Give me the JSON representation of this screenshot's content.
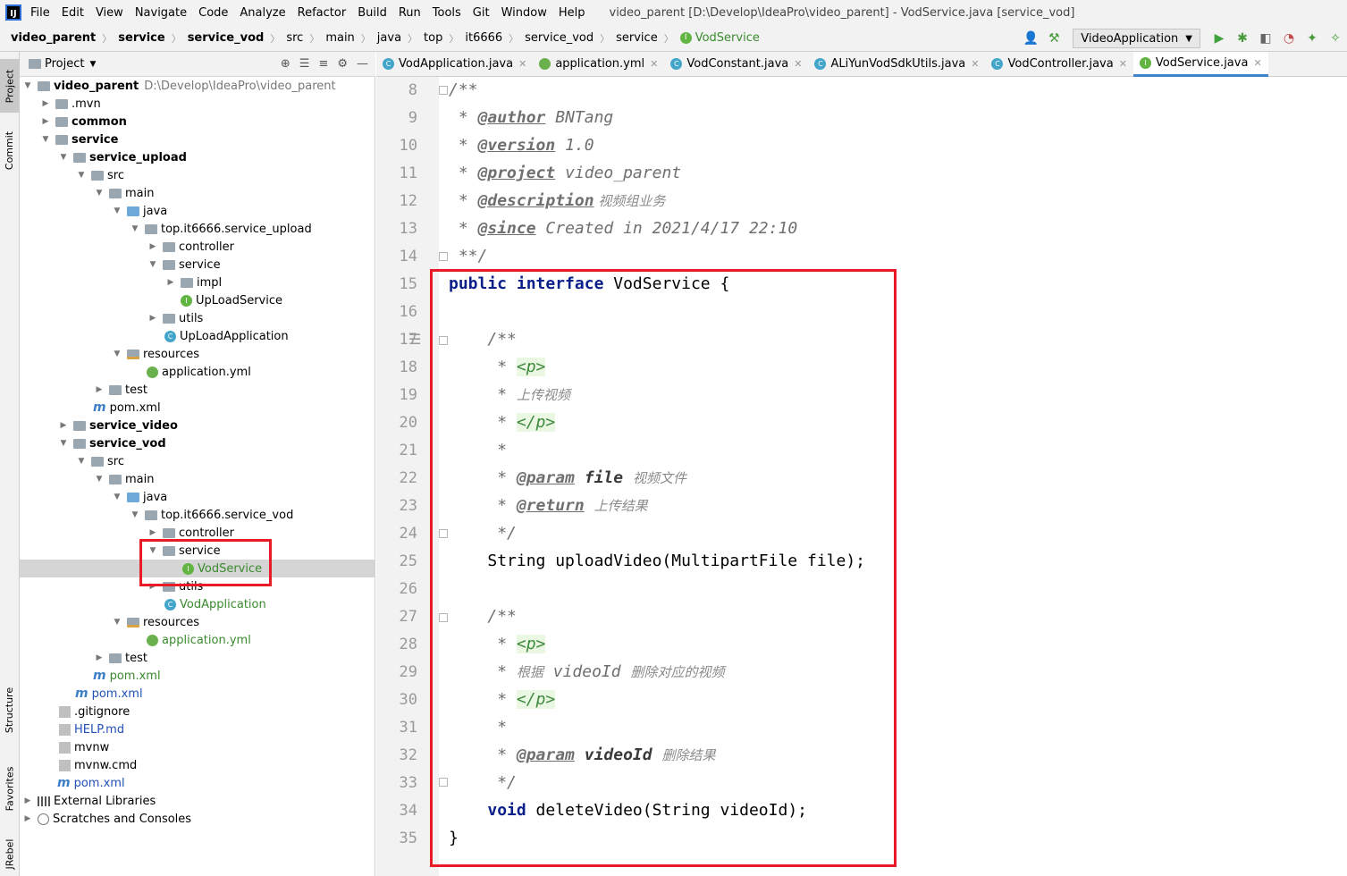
{
  "menubar": {
    "items": [
      "File",
      "Edit",
      "View",
      "Navigate",
      "Code",
      "Analyze",
      "Refactor",
      "Build",
      "Run",
      "Tools",
      "Git",
      "Window",
      "Help"
    ],
    "window_title": "video_parent [D:\\Develop\\IdeaPro\\video_parent] - VodService.java [service_vod]"
  },
  "breadcrumb": [
    "video_parent",
    "service",
    "service_vod",
    "src",
    "main",
    "java",
    "top",
    "it6666",
    "service_vod",
    "service",
    "VodService"
  ],
  "run_config": "VideoApplication",
  "left_tabs": [
    "Project",
    "Commit",
    "Structure",
    "Favorites",
    "JRebel"
  ],
  "project_panel": {
    "title": "Project"
  },
  "tree": [
    {
      "label": "video_parent",
      "extra": "D:\\Develop\\IdeaPro\\video_parent"
    },
    {
      "label": ".mvn"
    },
    {
      "label": "common"
    },
    {
      "label": "service"
    },
    {
      "label": "service_upload"
    },
    {
      "label": "src"
    },
    {
      "label": "main"
    },
    {
      "label": "java"
    },
    {
      "label": "top.it6666.service_upload"
    },
    {
      "label": "controller"
    },
    {
      "label": "service"
    },
    {
      "label": "impl"
    },
    {
      "label": "UpLoadService"
    },
    {
      "label": "utils"
    },
    {
      "label": "UpLoadApplication"
    },
    {
      "label": "resources"
    },
    {
      "label": "application.yml"
    },
    {
      "label": "test"
    },
    {
      "label": "pom.xml"
    },
    {
      "label": "service_video"
    },
    {
      "label": "service_vod"
    },
    {
      "label": "src"
    },
    {
      "label": "main"
    },
    {
      "label": "java"
    },
    {
      "label": "top.it6666.service_vod"
    },
    {
      "label": "controller"
    },
    {
      "label": "service"
    },
    {
      "label": "VodService"
    },
    {
      "label": "utils"
    },
    {
      "label": "VodApplication"
    },
    {
      "label": "resources"
    },
    {
      "label": "application.yml"
    },
    {
      "label": "test"
    },
    {
      "label": "pom.xml"
    },
    {
      "label": "pom.xml"
    },
    {
      "label": ".gitignore"
    },
    {
      "label": "HELP.md"
    },
    {
      "label": "mvnw"
    },
    {
      "label": "mvnw.cmd"
    },
    {
      "label": "pom.xml"
    },
    {
      "label": "External Libraries"
    },
    {
      "label": "Scratches and Consoles"
    }
  ],
  "tabs": [
    "VodApplication.java",
    "application.yml",
    "VodConstant.java",
    "ALiYunVodSdkUtils.java",
    "VodController.java",
    "VodService.java"
  ],
  "code": {
    "line_numbers": [
      "8",
      "9",
      "10",
      "11",
      "12",
      "13",
      "14",
      "15",
      "16",
      "17",
      "18",
      "19",
      "20",
      "21",
      "22",
      "23",
      "24",
      "25",
      "26",
      "27",
      "28",
      "29",
      "30",
      "31",
      "32",
      "33",
      "34",
      "35"
    ],
    "l8": "/**",
    "l9_tag": "@author",
    "l9_val": " BNTang",
    "l10_tag": "@version",
    "l10_val": " 1.0",
    "l11_tag": "@project",
    "l11_val": " video_parent",
    "l12_tag": "@description",
    "l12_val": " 视频组业务",
    "l13_tag": "@since",
    "l13_val": " Created in 2021/4/17 22:10",
    "l14": "**/",
    "l15_kw1": "public",
    "l15_kw2": "interface",
    "l15_rest": " VodService {",
    "l17": "/**",
    "p_open": "<p>",
    "p_close": "</p>",
    "l19_text": "上传视频",
    "param_tag": "@param",
    "l22_param": "file",
    "l22_desc": "视频文件",
    "return_tag": "@return",
    "l23_desc": "上传结果",
    "close_doc": "*/",
    "l25": "String uploadVideo(MultipartFile file);",
    "l29_a": "根据",
    "l29_b": " videoId ",
    "l29_c": "删除对应的视频",
    "l32_param": "videoId",
    "l32_desc": "删除结果",
    "l34_kw": "void",
    "l34_rest": " deleteVideo(String videoId);",
    "l35": "}",
    "star": "*"
  }
}
